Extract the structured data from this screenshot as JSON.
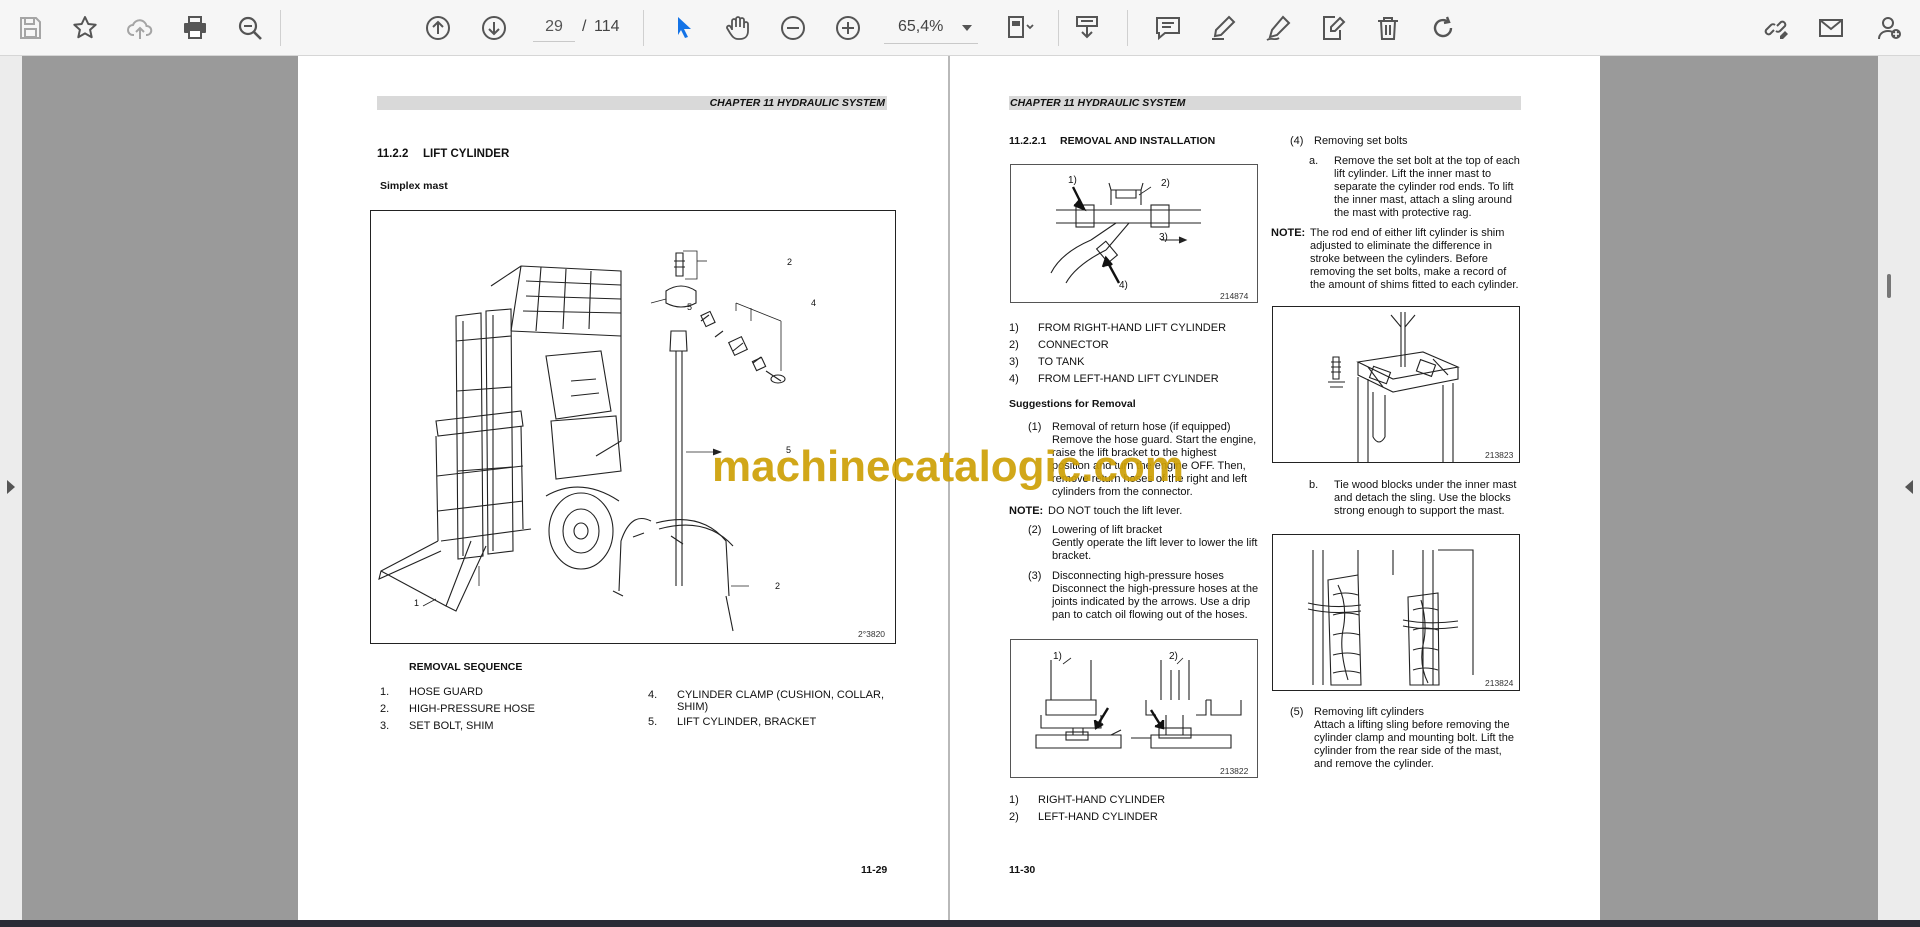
{
  "toolbar": {
    "page_current": "29",
    "page_separator": "/",
    "page_total": "114",
    "zoom_value": "65,4%"
  },
  "left_page": {
    "chapter_header": "CHAPTER 11 HYDRAULIC SYSTEM",
    "section_number": "11.2.2",
    "section_title": "LIFT CYLINDER",
    "subheading": "Simplex mast",
    "figure_number": "2°3820",
    "figure_callouts": [
      "1",
      "2",
      "3",
      "4",
      "5",
      "5",
      "2"
    ],
    "removal_sequence_title": "REMOVAL SEQUENCE",
    "sequence_left": [
      {
        "num": "1.",
        "text": "HOSE GUARD"
      },
      {
        "num": "2.",
        "text": "HIGH-PRESSURE HOSE"
      },
      {
        "num": "3.",
        "text": "SET BOLT, SHIM"
      }
    ],
    "sequence_right": [
      {
        "num": "4.",
        "text": "CYLINDER CLAMP (CUSHION, COLLAR,",
        "text2": "SHIM)"
      },
      {
        "num": "5.",
        "text": "LIFT CYLINDER, BRACKET"
      }
    ],
    "page_number": "11-29"
  },
  "right_page": {
    "chapter_header": "CHAPTER 11 HYDRAULIC SYSTEM",
    "section_number": "11.2.2.1",
    "section_title": "REMOVAL AND INSTALLATION",
    "fig1_number": "214874",
    "fig1_callouts": [
      "1)",
      "2)",
      "3)",
      "4)"
    ],
    "fig1_legend": [
      {
        "num": "1)",
        "text": "FROM RIGHT-HAND LIFT CYLINDER"
      },
      {
        "num": "2)",
        "text": "CONNECTOR"
      },
      {
        "num": "3)",
        "text": "TO TANK"
      },
      {
        "num": "4)",
        "text": "FROM LEFT-HAND LIFT CYLINDER"
      }
    ],
    "suggestions_title": "Suggestions for Removal",
    "step1_num": "(1)",
    "step1_lines": [
      "Removal of return hose (if equipped)",
      "Remove the hose guard. Start the engine,",
      "raise the lift bracket to the highest",
      "position and turn the engine OFF. Then,",
      "remove return hoses of the right and left",
      "cylinders from the connector."
    ],
    "note1_label": "NOTE:",
    "note1_text": "DO NOT touch the lift lever.",
    "step2_num": "(2)",
    "step2_lines": [
      "Lowering of lift bracket",
      "Gently operate the lift lever to lower the lift",
      "bracket."
    ],
    "step3_num": "(3)",
    "step3_lines": [
      "Disconnecting high-pressure hoses",
      "Disconnect the high-pressure hoses at the",
      "joints indicated by the arrows. Use a drip",
      "pan to catch oil flowing out of the hoses."
    ],
    "fig2_number": "213822",
    "fig2_callouts": [
      "1)",
      "2)"
    ],
    "fig2_legend": [
      {
        "num": "1)",
        "text": "RIGHT-HAND CYLINDER"
      },
      {
        "num": "2)",
        "text": "LEFT-HAND CYLINDER"
      }
    ],
    "step4_num": "(4)",
    "step4_title": "Removing set bolts",
    "step4a_label": "a.",
    "step4a_lines": [
      "Remove the set bolt at the top of each",
      "lift cylinder. Lift the inner mast to",
      "separate the cylinder rod ends. To lift",
      "the inner mast, attach a sling around",
      "the mast with protective rag."
    ],
    "note2_label": "NOTE:",
    "note2_lines": [
      "The rod end of either lift cylinder is shim",
      "adjusted to eliminate the difference in",
      "stroke between the cylinders. Before",
      "removing the set bolts, make a record of",
      "the amount of shims fitted to each cylinder."
    ],
    "fig3_number": "213823",
    "step4b_label": "b.",
    "step4b_lines": [
      "Tie wood blocks under the inner mast",
      "and detach the sling. Use the blocks",
      "strong enough to support the mast."
    ],
    "fig4_number": "213824",
    "step5_num": "(5)",
    "step5_lines": [
      "Removing lift cylinders",
      "Attach a lifting sling before removing the",
      "cylinder clamp and mounting bolt. Lift the",
      "cylinder from the rear side of the mast,",
      "and remove the cylinder."
    ],
    "page_number": "11-30"
  },
  "watermark": "machinecatalogic.com",
  "colors": {
    "toolbar_bg": "#f6f6f6",
    "icon_gray": "#5a5a5a",
    "select_blue": "#1473e6",
    "viewer_bg": "#9a9a9a",
    "watermark": "#cda005"
  }
}
